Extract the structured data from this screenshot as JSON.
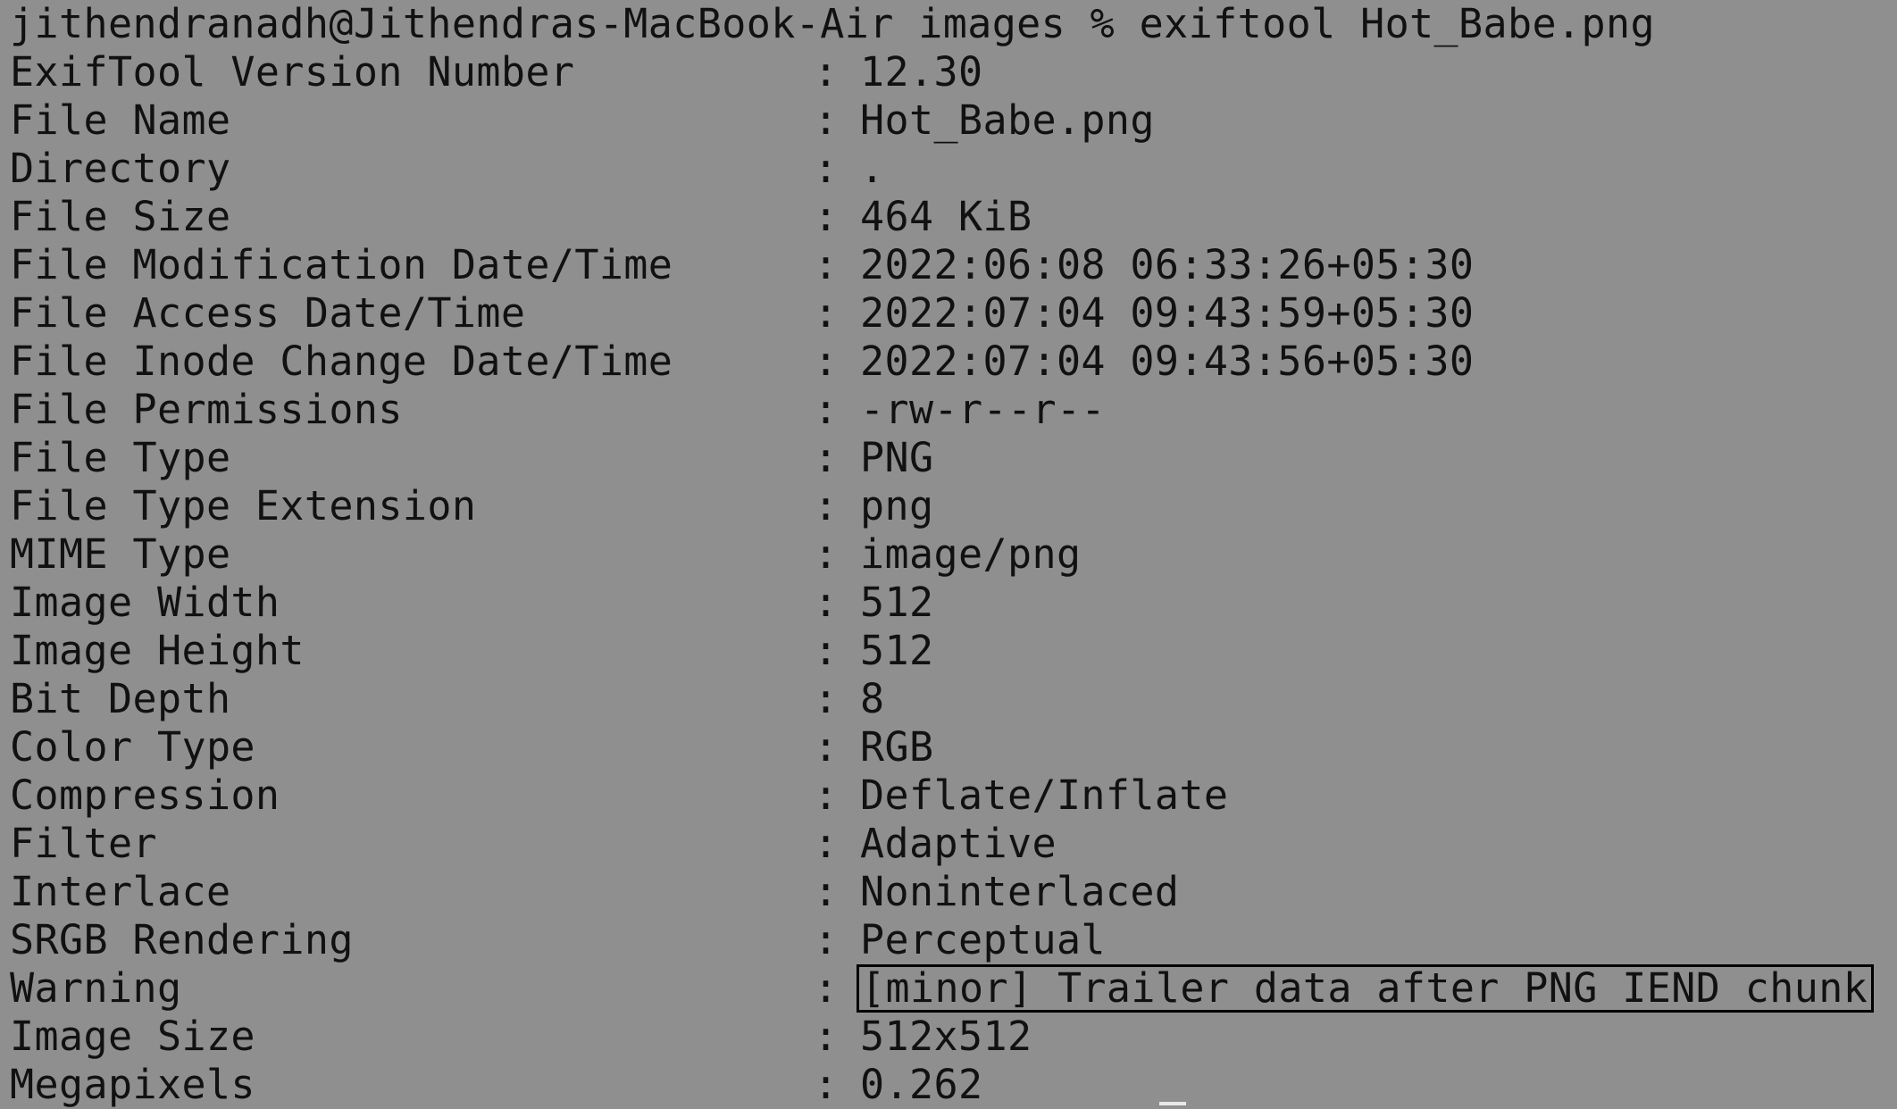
{
  "terminal": {
    "prompt": "jithendranadh@Jithendras-MacBook-Air images % exiftool Hot_Babe.png",
    "rows": [
      {
        "tag": "ExifTool Version Number",
        "value": "12.30"
      },
      {
        "tag": "File Name",
        "value": "Hot_Babe.png"
      },
      {
        "tag": "Directory",
        "value": "."
      },
      {
        "tag": "File Size",
        "value": "464 KiB"
      },
      {
        "tag": "File Modification Date/Time",
        "value": "2022:06:08 06:33:26+05:30"
      },
      {
        "tag": "File Access Date/Time",
        "value": "2022:07:04 09:43:59+05:30"
      },
      {
        "tag": "File Inode Change Date/Time",
        "value": "2022:07:04 09:43:56+05:30"
      },
      {
        "tag": "File Permissions",
        "value": "-rw-r--r--"
      },
      {
        "tag": "File Type",
        "value": "PNG"
      },
      {
        "tag": "File Type Extension",
        "value": "png"
      },
      {
        "tag": "MIME Type",
        "value": "image/png"
      },
      {
        "tag": "Image Width",
        "value": "512"
      },
      {
        "tag": "Image Height",
        "value": "512"
      },
      {
        "tag": "Bit Depth",
        "value": "8"
      },
      {
        "tag": "Color Type",
        "value": "RGB"
      },
      {
        "tag": "Compression",
        "value": "Deflate/Inflate"
      },
      {
        "tag": "Filter",
        "value": "Adaptive"
      },
      {
        "tag": "Interlace",
        "value": "Noninterlaced"
      },
      {
        "tag": "SRGB Rendering",
        "value": "Perceptual"
      },
      {
        "tag": "Warning",
        "value": "[minor] Trailer data after PNG IEND chunk"
      },
      {
        "tag": "Image Size",
        "value": "512x512"
      },
      {
        "tag": "Megapixels",
        "value": "0.262"
      }
    ],
    "separator": ":"
  },
  "colors": {
    "background": "#8f8f8f",
    "text": "#111111",
    "highlight_border": "#000000"
  }
}
